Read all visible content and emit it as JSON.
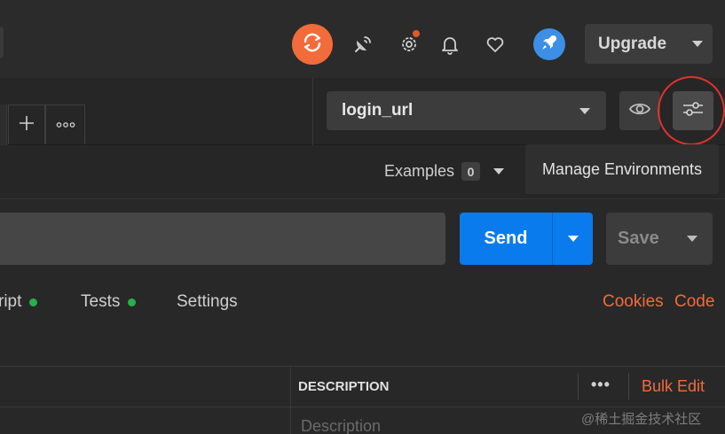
{
  "header": {
    "sync_icon": "sync-icon",
    "icons": [
      "satellite-icon",
      "gear-icon",
      "bell-icon",
      "heart-icon"
    ],
    "avatar_icon": "rocket-icon",
    "upgrade_label": "Upgrade"
  },
  "tabs": {
    "add_icon": "plus-icon",
    "more_icon": "more-icon"
  },
  "environment": {
    "selected": "login_url",
    "eye_icon": "eye-icon",
    "manage_icon": "sliders-icon",
    "tooltip": "Manage Environments"
  },
  "examples": {
    "label": "Examples",
    "count": "0"
  },
  "request": {
    "url_value": "",
    "send_label": "Send",
    "save_label": "Save"
  },
  "request_tabs": [
    {
      "label": "ript",
      "dot": true
    },
    {
      "label": "Tests",
      "dot": true
    },
    {
      "label": "Settings",
      "dot": false
    }
  ],
  "links": {
    "cookies": "Cookies",
    "code": "Code"
  },
  "params_table": {
    "description_header": "DESCRIPTION",
    "more_label": "•••",
    "bulk_edit": "Bulk Edit",
    "description_placeholder": "Description"
  },
  "watermark": "@稀土掘金技术社区",
  "colors": {
    "accent_orange": "#f26b3a",
    "send_blue": "#097bed",
    "status_green": "#26b24a",
    "highlight_red": "#e0322c"
  }
}
